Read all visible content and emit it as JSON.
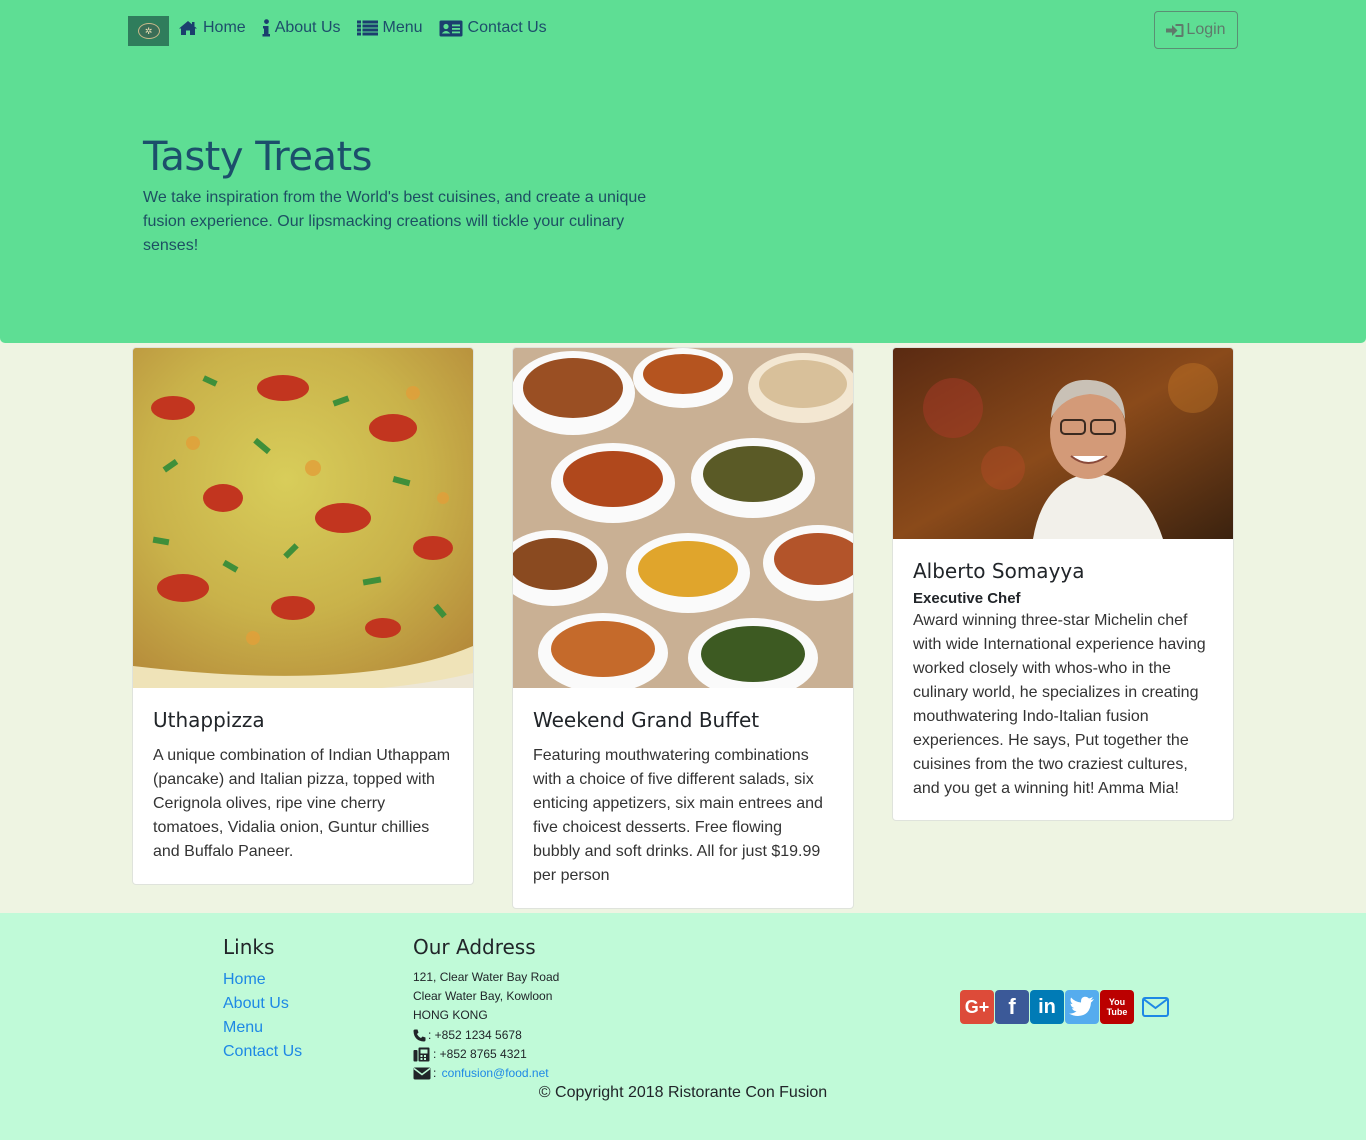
{
  "nav": {
    "brand_icon": "restaurant-logo",
    "items": [
      {
        "label": "Home",
        "icon": "home-icon"
      },
      {
        "label": "About Us",
        "icon": "info-icon"
      },
      {
        "label": "Menu",
        "icon": "list-icon"
      },
      {
        "label": "Contact Us",
        "icon": "address-card-icon"
      }
    ],
    "login_label": "Login",
    "login_icon": "sign-in-icon"
  },
  "jumbotron": {
    "title": "Tasty Treats",
    "text": "We take inspiration from the World's best cuisines, and create a unique fusion experience. Our lipsmacking creations will tickle your culinary senses!"
  },
  "cards": [
    {
      "image": "uthappizza-photo",
      "title": "Uthappizza",
      "text": "A unique combination of Indian Uthappam (pancake) and Italian pizza, topped with Cerignola olives, ripe vine cherry tomatoes, Vidalia onion, Guntur chillies and Buffalo Paneer."
    },
    {
      "image": "buffet-photo",
      "title": "Weekend Grand Buffet",
      "text": "Featuring mouthwatering combinations with a choice of five different salads, six enticing appetizers, six main entrees and five choicest desserts. Free flowing bubbly and soft drinks. All for just $19.99 per person"
    },
    {
      "image": "chef-photo",
      "title": "Alberto Somayya",
      "subtitle": "Executive Chef",
      "text": "Award winning three-star Michelin chef with wide International experience having worked closely with whos-who in the culinary world, he specializes in creating mouthwatering Indo-Italian fusion experiences. He says, Put together the cuisines from the two craziest cultures, and you get a winning hit! Amma Mia!"
    }
  ],
  "footer": {
    "links_heading": "Links",
    "links": [
      "Home",
      "About Us",
      "Menu",
      "Contact Us"
    ],
    "address_heading": "Our Address",
    "address_lines": [
      "121, Clear Water Bay Road",
      "Clear Water Bay, Kowloon",
      "HONG KONG"
    ],
    "phone": ": +852 1234 5678",
    "fax": ": +852 8765 4321",
    "email": "confusion@food.net",
    "social": [
      {
        "name": "google-plus-icon",
        "label": "G+",
        "color": "#dd4b39"
      },
      {
        "name": "facebook-icon",
        "label": "f",
        "color": "#3b5998"
      },
      {
        "name": "linkedin-icon",
        "label": "in",
        "color": "#007bb6"
      },
      {
        "name": "twitter-icon",
        "label": "t",
        "color": "#55acee"
      },
      {
        "name": "youtube-icon",
        "label": "You Tube",
        "color": "#bb0000"
      }
    ],
    "mail_icon_color": "#1e88e5",
    "copyright": "© Copyright 2018 Ristorante Con Fusion"
  },
  "colors": {
    "navbar": "#5ede94",
    "jumbotron": "#5ede94",
    "body": "#eef4e2",
    "footer": "#c0fad8",
    "link": "#1e88e5",
    "title": "#1c4f6b"
  }
}
